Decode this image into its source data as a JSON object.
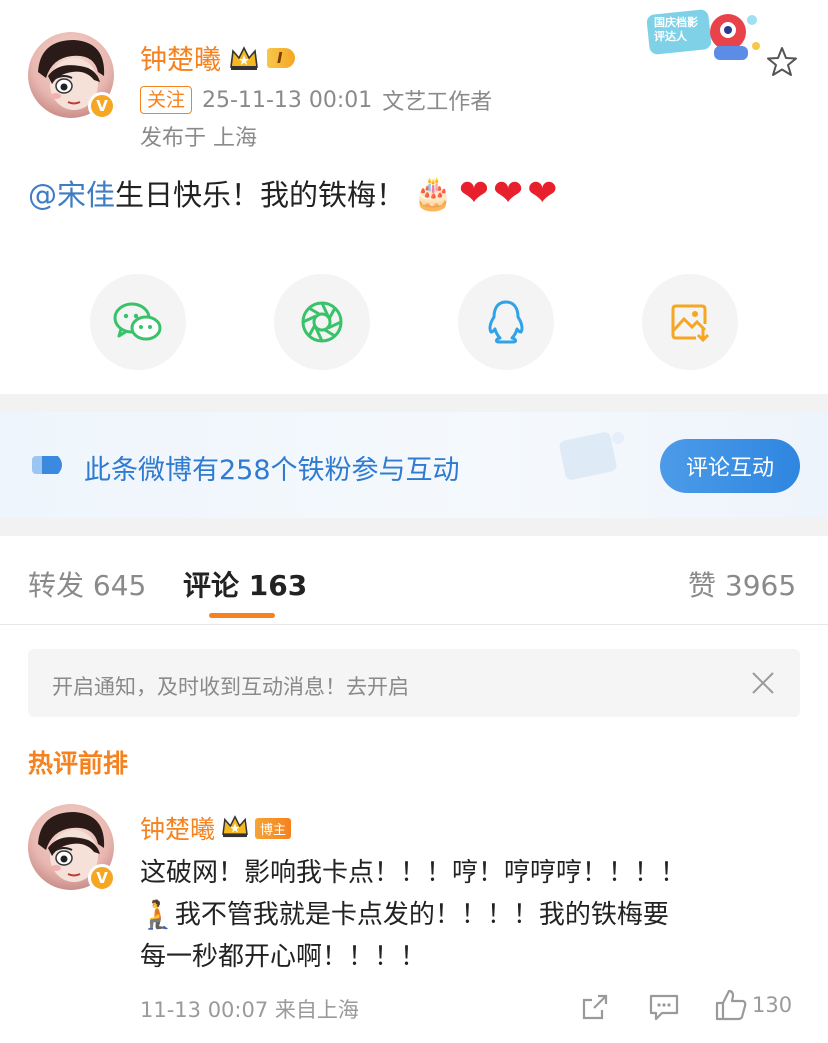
{
  "post": {
    "author": "钟楚曦",
    "level_badge": "I",
    "follow_label": "关注",
    "timestamp": "25-11-13 00:01",
    "author_title": "文艺工作者",
    "location": "发布于 上海",
    "mention": "@宋佳",
    "text": " 生日快乐！我的铁梅！",
    "emoji_cake": "🎂",
    "hearts": "❤❤❤",
    "decoration_badge": "国庆档影评达人"
  },
  "share": {
    "items": [
      {
        "name": "wechat",
        "color": "#39c26a"
      },
      {
        "name": "moments",
        "color": "#39c26a"
      },
      {
        "name": "qq",
        "color": "#2fa2e8"
      },
      {
        "name": "save-image",
        "color": "#f5a623"
      }
    ]
  },
  "fans_banner": {
    "text": "此条微博有258个铁粉参与互动",
    "button": "评论互动"
  },
  "tabs": {
    "repost": "转发 645",
    "comments": "评论 163",
    "likes": "赞 3965"
  },
  "notice": {
    "text": "开启通知，及时收到互动消息！去开启"
  },
  "hot_section": {
    "title": "热评前排"
  },
  "comment": {
    "author": "钟楚曦",
    "role_badge": "博主",
    "line1": "这破网！影响我卡点！！！哼！哼哼哼！！！！",
    "line2": " 我不管我就是卡点发的！！！！我的铁梅要",
    "line3": "每一秒都开心啊！！！！",
    "emoji": "🧎",
    "meta": "11-13 00:07 来自上海",
    "like_count": "130"
  },
  "colors": {
    "accent_orange": "#f5821f",
    "link_blue": "#3f7cc2",
    "banner_blue": "#2f7bd1"
  }
}
